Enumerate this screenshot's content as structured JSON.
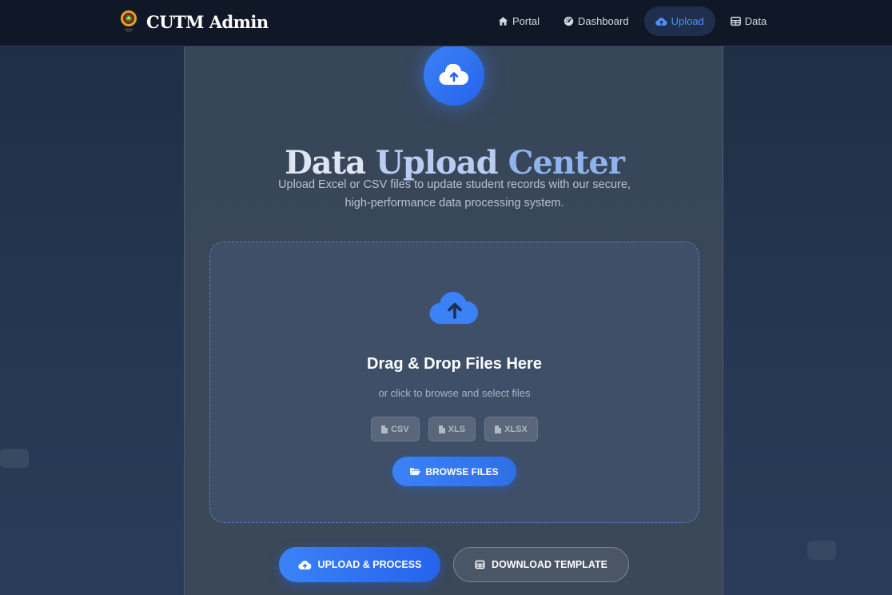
{
  "brand": {
    "name": "CUTM Admin"
  },
  "nav": {
    "items": [
      {
        "label": "Portal",
        "icon": "home-icon"
      },
      {
        "label": "Dashboard",
        "icon": "dashboard-icon"
      },
      {
        "label": "Upload",
        "icon": "cloud-upload-icon",
        "active": true
      },
      {
        "label": "Data",
        "icon": "table-icon"
      }
    ]
  },
  "hero": {
    "title_part1": "Data",
    "title_part2": "Upload",
    "title_part3": "Center",
    "subtitle": "Upload Excel or CSV files to update student records with our secure, high-performance data processing system."
  },
  "dropzone": {
    "title": "Drag & Drop Files Here",
    "subtitle": "or click to browse and select files",
    "formats": [
      "CSV",
      "XLS",
      "XLSX"
    ],
    "browse_label": "BROWSE FILES"
  },
  "actions": {
    "upload_label": "UPLOAD & PROCESS",
    "template_label": "DOWNLOAD TEMPLATE"
  },
  "colors": {
    "accent": "#3b82f6",
    "navbar_bg": "#101827",
    "active_nav_text": "#4f8ff7"
  }
}
